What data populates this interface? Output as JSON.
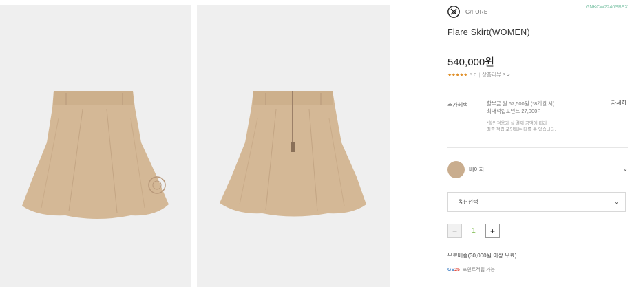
{
  "images": [
    {
      "name": "skirt-front-image",
      "alt": "Flare skirt front view"
    },
    {
      "name": "skirt-back-image",
      "alt": "Flare skirt back view"
    }
  ],
  "brand": {
    "name": "G/FORE",
    "sku": "GNKCW2240SBEX",
    "logo_icon": "gfore-logo-icon"
  },
  "product": {
    "title": "Flare Skirt(WOMEN)",
    "price": "540,000원"
  },
  "rating": {
    "stars": "★★★★★",
    "score": "5.0",
    "separator": "|",
    "reviews_label": "상품리뷰 3",
    "arrow": ">",
    "star_color": "#e0902a"
  },
  "benefits": {
    "label": "추가혜택",
    "line1": "할부금 월 67,500원 (*8개월 시)",
    "line2": "최대적립포인트 27,000P",
    "note1": "*할인적용과 실 결제 금액에 따라",
    "note2": "최종 적립 포인트는 다를 수 있습니다.",
    "detail_link": "자세히"
  },
  "color_option": {
    "name": "베이지",
    "swatch_color": "#c9ad8e",
    "chevron": "⌄"
  },
  "option_select": {
    "label": "옵션선택",
    "chevron": "⌄"
  },
  "quantity": {
    "minus": "−",
    "value": "1",
    "plus": "+",
    "value_color": "#7ab94a"
  },
  "shipping": {
    "text": "무료배송(30,000원 이상 무료)"
  },
  "gs_point": {
    "badge_gs": "GS",
    "badge_n": "25",
    "text": "포인트적립 가능"
  }
}
